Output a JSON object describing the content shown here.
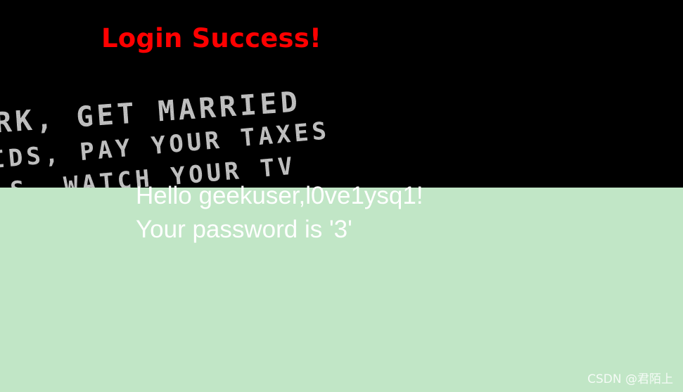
{
  "page": {
    "colors": {
      "top_background": "#000000",
      "bottom_background": "#c1e6c6",
      "title_color": "#ff0000",
      "message_color": "#ffffff"
    }
  },
  "header": {
    "title": "Login Success!"
  },
  "background_image": {
    "lines": [
      "RK, GET MARRIED",
      "IDS, PAY YOUR TAXES",
      "LS, WATCH YOUR TV"
    ]
  },
  "message": {
    "greeting": "Hello geekuser,l0ve1ysq1!",
    "password": "Your password is '3'"
  },
  "watermark": {
    "text": "CSDN @君陌上"
  }
}
